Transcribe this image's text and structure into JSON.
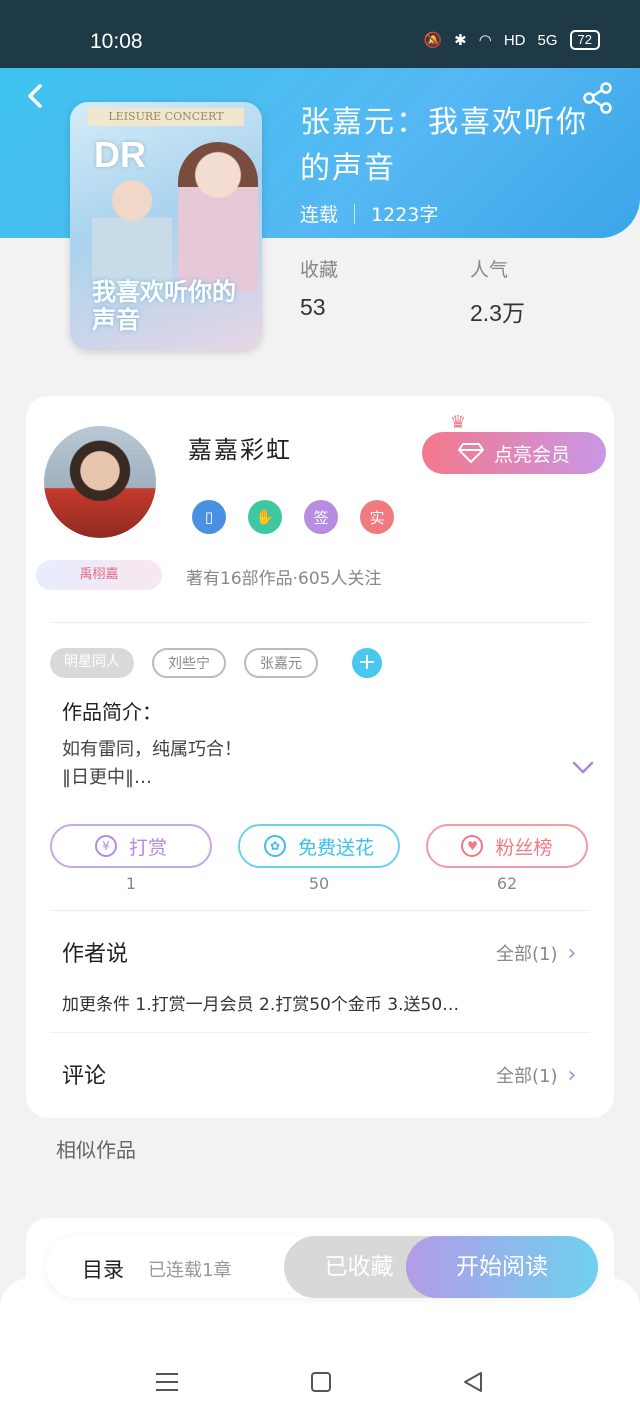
{
  "status_bar": {
    "time": "10:08",
    "network": "5G",
    "hd": "HD",
    "battery": "72"
  },
  "book": {
    "title": "张嘉元：我喜欢听你的声音",
    "status": "连载",
    "word_count": "1223字",
    "cover": {
      "banner": "LEISURE CONCERT",
      "big_text": "DR",
      "title": "我喜欢听你的声音"
    }
  },
  "stats": {
    "favorites_label": "收藏",
    "favorites_value": "53",
    "popularity_label": "人气",
    "popularity_value": "2.3万"
  },
  "author": {
    "name": "嘉嘉彩虹",
    "badge": "禹栩嘉",
    "vip_label": "点亮会员",
    "icons": [
      "phone-icon",
      "handshake-icon",
      "sign-icon",
      "real-icon"
    ],
    "icon_labels": [
      "",
      "",
      "签",
      "实"
    ],
    "stats_text": "著有16部作品·605人关注"
  },
  "tags": [
    "明星同人",
    "刘些宁",
    "张嘉元"
  ],
  "intro": {
    "title": "作品简介：",
    "line1": "如有雷同，纯属巧合！",
    "line2": "‖日更中‖…"
  },
  "actions": [
    {
      "label": "打赏",
      "count": "1",
      "color": "#b38be0",
      "icon": "¥"
    },
    {
      "label": "免费送花",
      "count": "50",
      "color": "#3fc0ec",
      "icon": "✿"
    },
    {
      "label": "粉丝榜",
      "count": "62",
      "color": "#ef7a85",
      "icon": "♥"
    }
  ],
  "author_says": {
    "title": "作者说",
    "link": "全部(1)",
    "content": "加更条件 1.打赏一月会员 2.打赏50个金币 3.送50…"
  },
  "comments": {
    "title": "评论",
    "link": "全部(1)"
  },
  "similar": {
    "title": "相似作品"
  },
  "bottom_bar": {
    "toc": "目录",
    "toc_sub": "已连载1章",
    "collected": "已收藏",
    "start_reading": "开始阅读"
  }
}
